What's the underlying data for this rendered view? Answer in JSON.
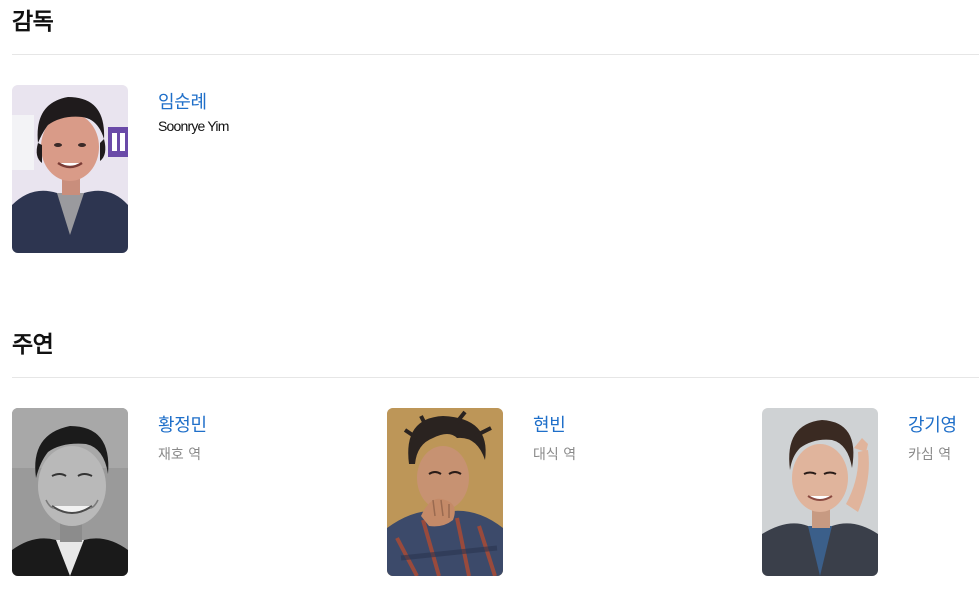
{
  "director_section": {
    "title": "감독",
    "people": [
      {
        "name": "임순례",
        "name_en": "Soonrye Yim"
      }
    ]
  },
  "cast_section": {
    "title": "주연",
    "people": [
      {
        "name": "황정민",
        "role": "재호 역"
      },
      {
        "name": "현빈",
        "role": "대식 역"
      },
      {
        "name": "강기영",
        "role": "카심 역"
      }
    ]
  }
}
